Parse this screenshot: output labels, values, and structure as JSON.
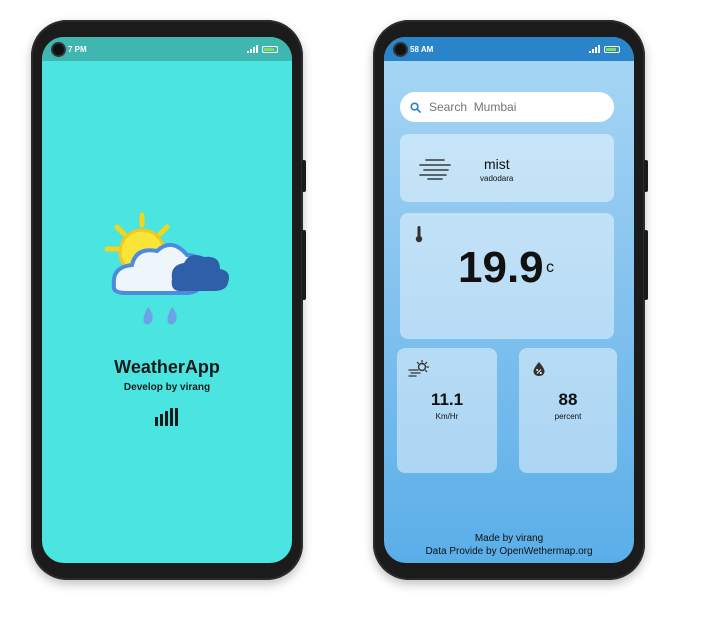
{
  "left_phone": {
    "status_time": "7 PM",
    "app_title": "WeatherApp",
    "app_subtitle": "Develop by virang",
    "colors": {
      "screen": "#4ae4e1",
      "statusbar": "#3fb7b0"
    },
    "icons": [
      "weather-logo-icon",
      "loader-icon"
    ]
  },
  "right_phone": {
    "status_time": "58 AM",
    "search": {
      "value": "Search  Mumbai",
      "icon": "search-icon"
    },
    "condition": {
      "label": "mist",
      "city": "vadodara",
      "icon": "mist-icon"
    },
    "temperature": {
      "value": "19.9",
      "unit": "c",
      "icon": "thermometer-icon"
    },
    "wind": {
      "value": "11.1",
      "unit": "Km/Hr",
      "icon": "wind-icon"
    },
    "humidity": {
      "value": "88",
      "unit": "percent",
      "icon": "humidity-icon"
    },
    "footer": {
      "made_by": "Made by virang",
      "data_provider": "Data Provide by OpenWethermap.org"
    },
    "colors": {
      "statusbar": "#2a84c9",
      "gradient_top": "#a9d7f4",
      "gradient_bottom": "#5aaee8"
    }
  }
}
